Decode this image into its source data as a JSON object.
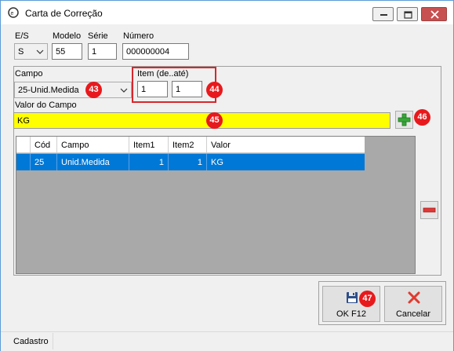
{
  "window": {
    "title": "Carta de Correção"
  },
  "fields": {
    "es_label": "E/S",
    "es_value": "S",
    "modelo_label": "Modelo",
    "modelo_value": "55",
    "serie_label": "Série",
    "serie_value": "1",
    "numero_label": "Número",
    "numero_value": "000000004",
    "campo_label": "Campo",
    "campo_value": "25-Unid.Medida",
    "item_label": "Item (de..até)",
    "item_de": "1",
    "item_ate": "1",
    "valor_label": "Valor do Campo",
    "valor_value": "KG"
  },
  "badges": {
    "b43": "43",
    "b44": "44",
    "b45": "45",
    "b46": "46",
    "b47": "47"
  },
  "grid": {
    "columns": [
      "Cód",
      "Campo",
      "Item1",
      "Item2",
      "Valor"
    ],
    "rows": [
      {
        "cod": "25",
        "campo": "Unid.Medida",
        "item1": "1",
        "item2": "1",
        "valor": "KG"
      }
    ]
  },
  "buttons": {
    "ok_label": "OK  F12",
    "cancel_label": "Cancelar"
  },
  "status": {
    "tab": "Cadastro"
  },
  "icons": {
    "app": "app-logo-icon",
    "add": "plus-icon",
    "remove": "minus-icon",
    "save": "floppy-disk-icon",
    "cancel": "red-x-icon"
  },
  "colors": {
    "highlight_field": "#ffff00",
    "selection": "#0078d7",
    "badge": "#e8191c",
    "close_button": "#c75050"
  }
}
